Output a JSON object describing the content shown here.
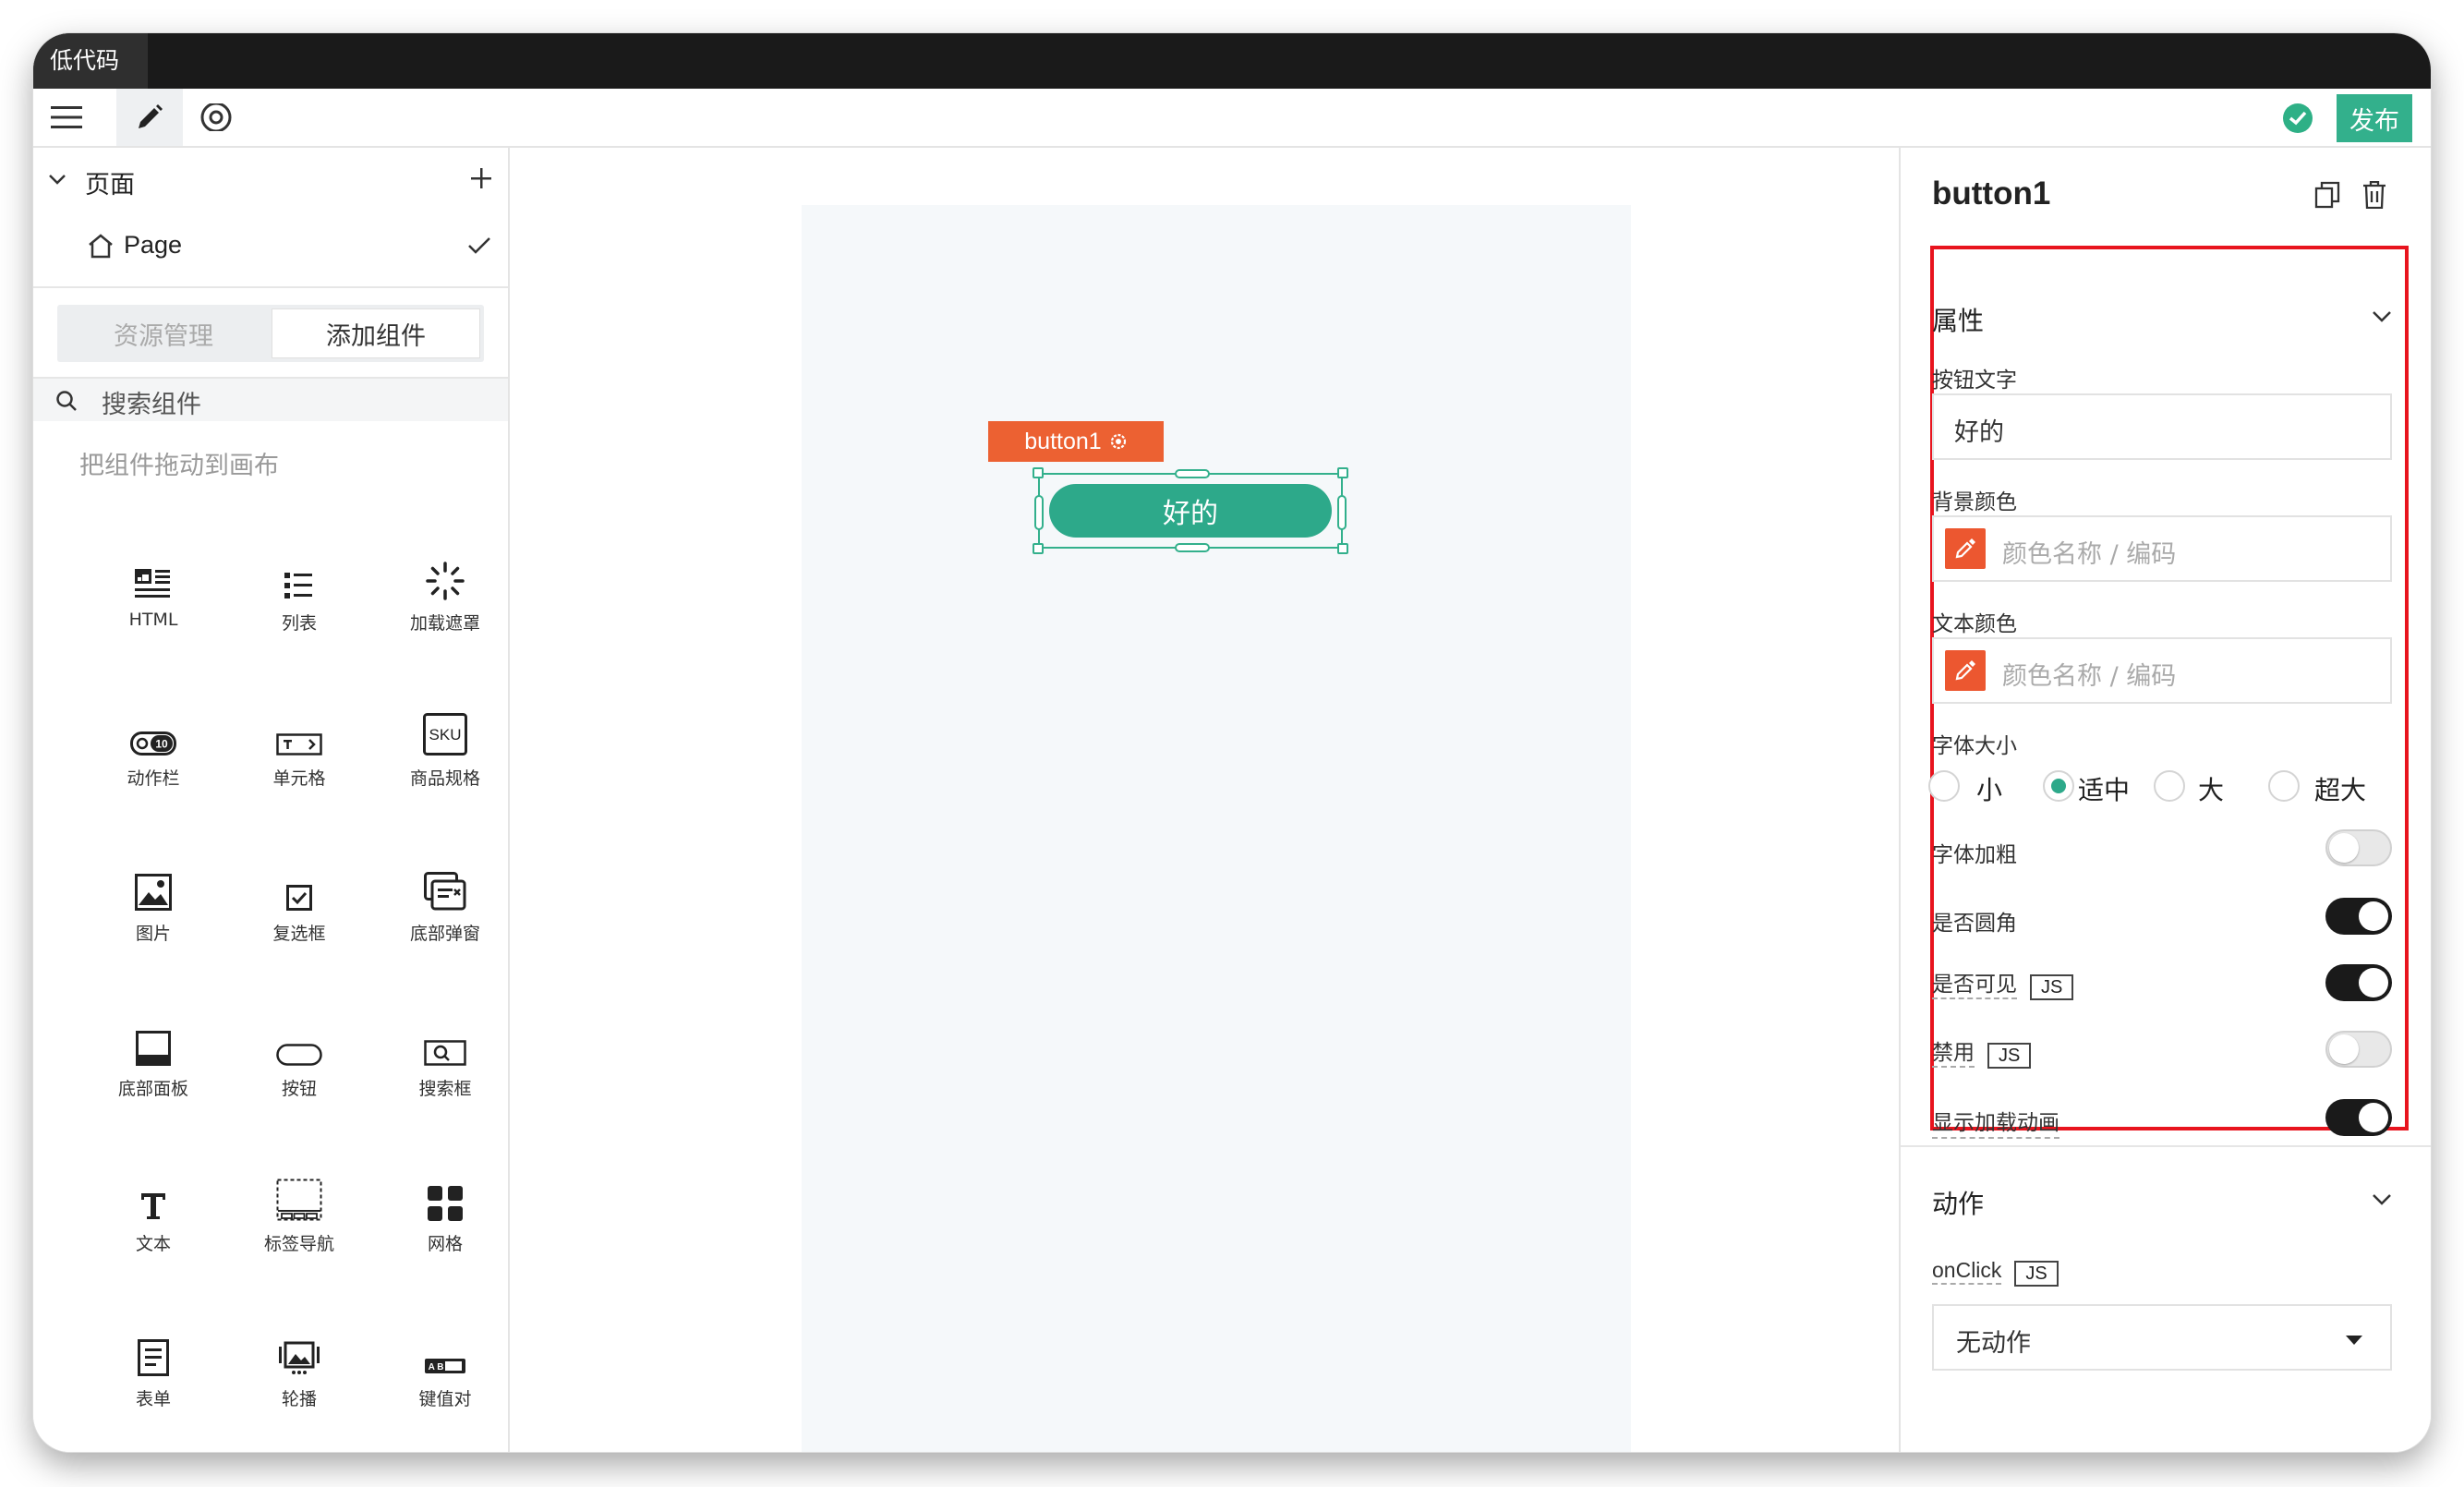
{
  "titlebar": {
    "tab_title": "低代码"
  },
  "toolbar": {
    "publish_label": "发布"
  },
  "left_panel": {
    "pages_header": "页面",
    "page_item": "Page",
    "tabs": {
      "assets": "资源管理",
      "add_component": "添加组件"
    },
    "search_placeholder": "搜索组件",
    "drag_hint": "把组件拖动到画布",
    "components": [
      {
        "label": "HTML",
        "icon": "html-icon"
      },
      {
        "label": "列表",
        "icon": "list-icon"
      },
      {
        "label": "加载遮罩",
        "icon": "loading-icon"
      },
      {
        "label": "动作栏",
        "icon": "action-bar-icon"
      },
      {
        "label": "单元格",
        "icon": "cell-icon"
      },
      {
        "label": "商品规格",
        "icon": "sku-icon"
      },
      {
        "label": "图片",
        "icon": "image-icon"
      },
      {
        "label": "复选框",
        "icon": "checkbox-icon"
      },
      {
        "label": "底部弹窗",
        "icon": "popup-icon"
      },
      {
        "label": "底部面板",
        "icon": "bottom-panel-icon"
      },
      {
        "label": "按钮",
        "icon": "button-icon"
      },
      {
        "label": "搜索框",
        "icon": "search-box-icon"
      },
      {
        "label": "文本",
        "icon": "text-icon"
      },
      {
        "label": "标签导航",
        "icon": "tabs-icon"
      },
      {
        "label": "网格",
        "icon": "grid-icon"
      },
      {
        "label": "表单",
        "icon": "form-icon"
      },
      {
        "label": "轮播",
        "icon": "carousel-icon"
      },
      {
        "label": "键值对",
        "icon": "key-value-icon"
      }
    ],
    "sku_text": "SKU",
    "action_bar_badge": "10",
    "key_value_text": "A B"
  },
  "canvas": {
    "selected_tag": "button1",
    "button_text": "好的"
  },
  "right_panel": {
    "component_name": "button1",
    "properties_title": "属性",
    "button_text_label": "按钮文字",
    "button_text_value": "好的",
    "bg_color_label": "背景颜色",
    "bg_color_placeholder": "颜色名称 / 编码",
    "text_color_label": "文本颜色",
    "text_color_placeholder": "颜色名称 / 编码",
    "font_size_label": "字体大小",
    "font_size_options": [
      "小",
      "适中",
      "大",
      "超大"
    ],
    "font_size_selected": "适中",
    "bold_label": "字体加粗",
    "bold_on": false,
    "rounded_label": "是否圆角",
    "rounded_on": true,
    "visible_label": "是否可见",
    "visible_on": true,
    "disabled_label": "禁用",
    "disabled_on": false,
    "loading_label": "显示加载动画",
    "loading_on": true,
    "js_badge": "JS",
    "actions_title": "动作",
    "onclick_label": "onClick",
    "onclick_value": "无动作"
  },
  "colors": {
    "accent": "#2da98a",
    "publish": "#33b08c",
    "tag": "#ec6132",
    "highlight": "#e8141e",
    "picker": "#ec5730"
  }
}
